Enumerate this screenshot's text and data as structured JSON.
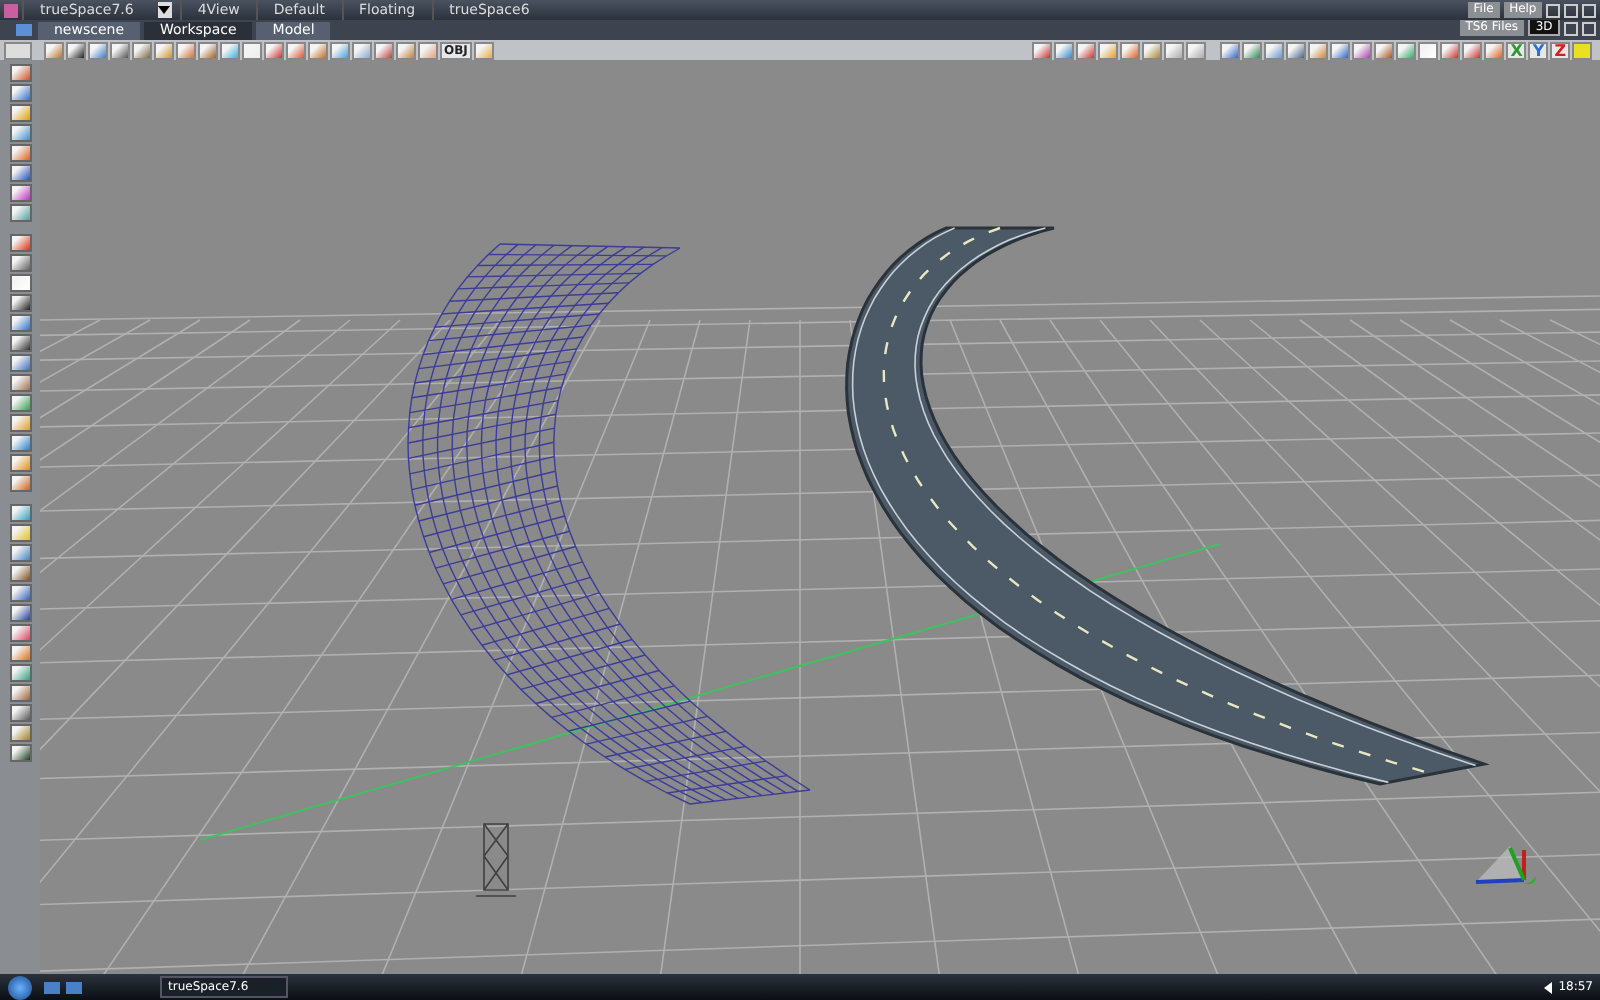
{
  "window": {
    "title": "trueSpace7.6"
  },
  "layout_tabs": [
    {
      "label": "4View",
      "selected": false
    },
    {
      "label": "Default",
      "selected": false
    },
    {
      "label": "Floating",
      "selected": false
    },
    {
      "label": "trueSpace6",
      "selected": false
    }
  ],
  "menu": [
    "File",
    "Help"
  ],
  "view_tabs": [
    {
      "label": "newscene",
      "selected": false
    },
    {
      "label": "Workspace",
      "selected": true
    },
    {
      "label": "Model",
      "selected": false
    }
  ],
  "view_menu": {
    "files": "TS6 Files",
    "mode": "3D"
  },
  "toolbar": {
    "obj_label": "OBJ",
    "axis_labels": [
      "X",
      "Y",
      "Z"
    ]
  },
  "taskbar": {
    "task": "trueSpace7.6",
    "clock": "18:57"
  }
}
